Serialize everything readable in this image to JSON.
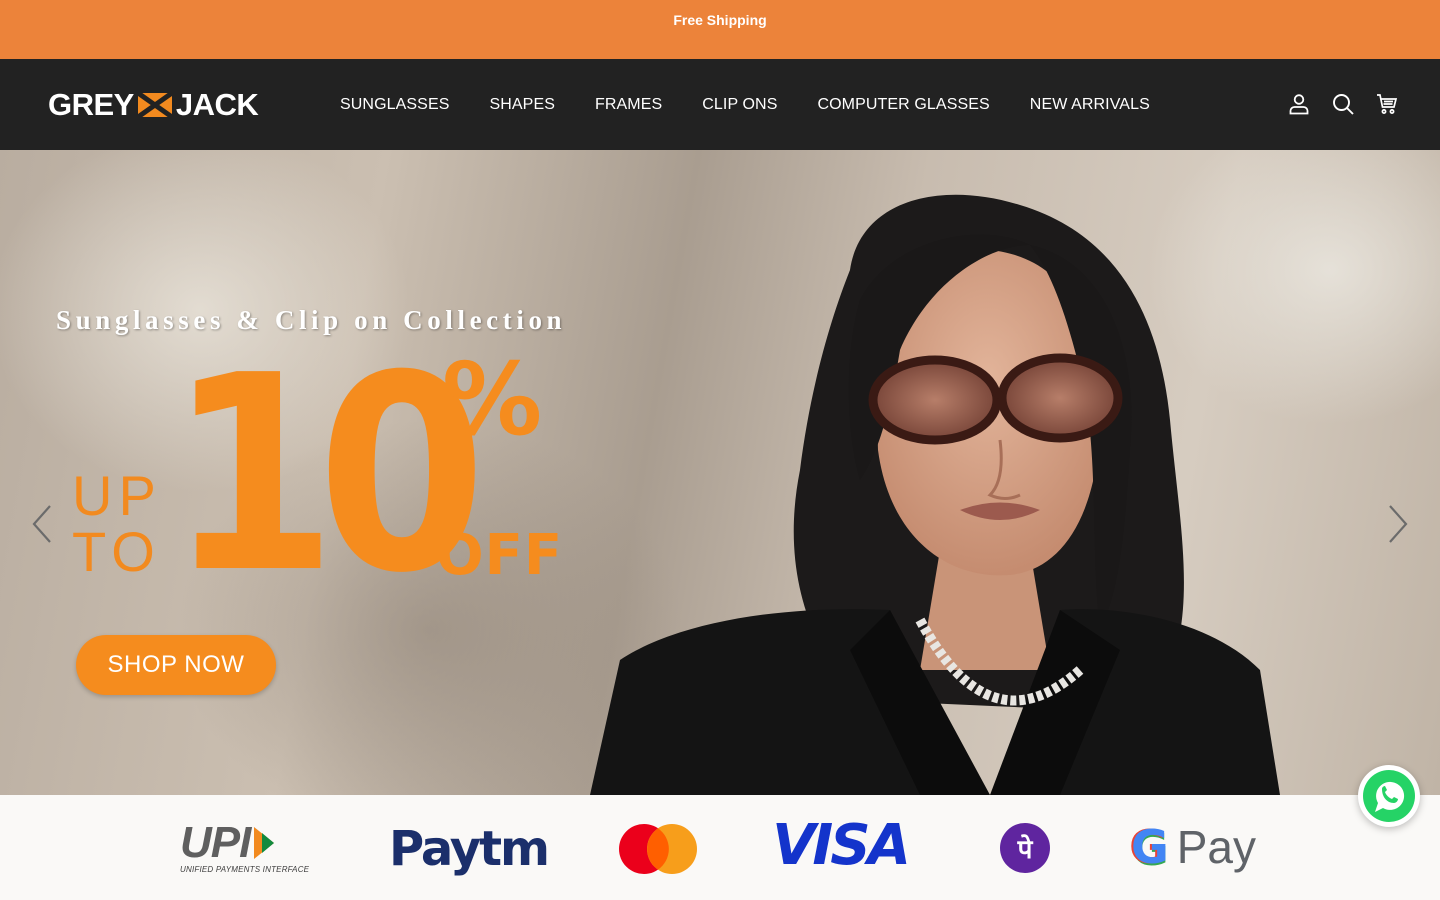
{
  "announcement": {
    "text": "Free Shipping"
  },
  "header": {
    "logo_left": "GREY",
    "logo_right": "JACK",
    "nav": [
      {
        "label": "SUNGLASSES"
      },
      {
        "label": "SHAPES"
      },
      {
        "label": "FRAMES"
      },
      {
        "label": "CLIP ONS"
      },
      {
        "label": "COMPUTER GLASSES"
      },
      {
        "label": "NEW ARRIVALS"
      }
    ],
    "icons": [
      "account-icon",
      "search-icon",
      "cart-icon"
    ]
  },
  "hero": {
    "tagline": "Sunglasses & Clip on Collection",
    "up": "UP",
    "to": "TO",
    "number": "10",
    "percent": "%",
    "off": "OFF",
    "cta": "SHOP NOW",
    "prev_icon": "chevron-left-icon",
    "next_icon": "chevron-right-icon"
  },
  "payments": {
    "upi_main": "UPI",
    "upi_sub": "UNIFIED PAYMENTS INTERFACE",
    "paytm": "Paytm",
    "visa": "VISA",
    "phonepe": "पे",
    "gpay_g": "G",
    "gpay_text": "Pay"
  },
  "colors": {
    "accent_orange": "#ec833a",
    "header_bg": "#222222",
    "cta_orange": "#f58c1e",
    "whatsapp_green": "#25d366"
  }
}
